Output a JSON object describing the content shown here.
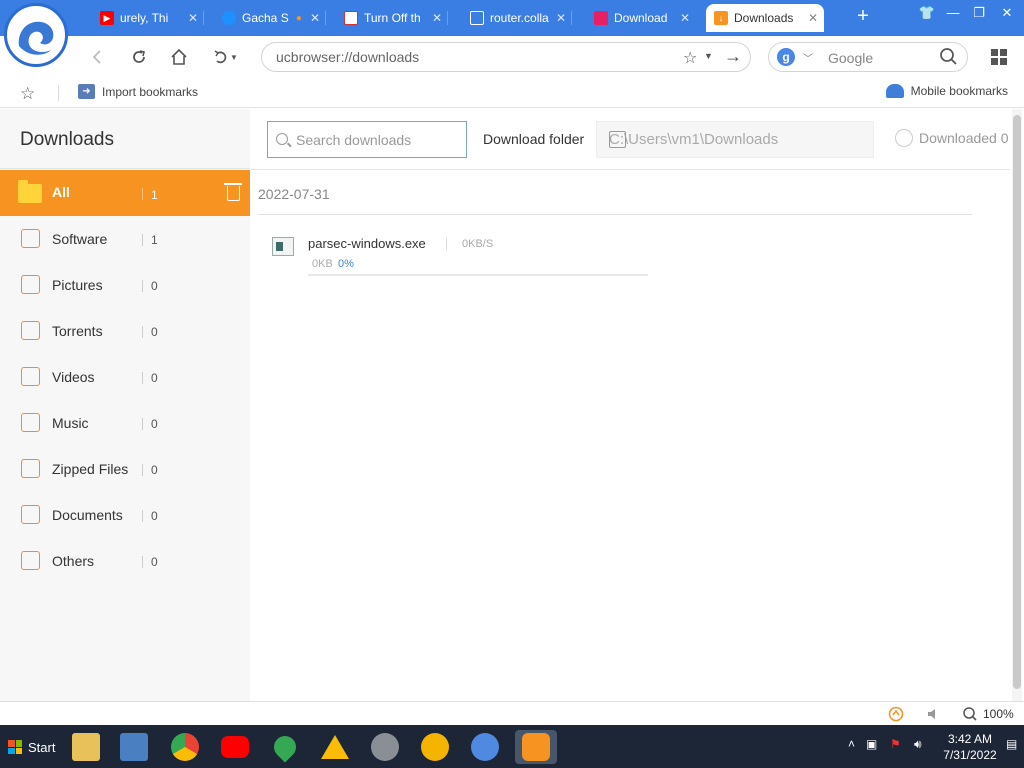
{
  "browser": {
    "tabs": [
      {
        "label": "urely, Thi",
        "icon": "youtube-icon",
        "color": "#ff0000"
      },
      {
        "label": "Gacha S",
        "icon": "edge-icon",
        "color": "#1e90ff"
      },
      {
        "label": "Turn Off th",
        "icon": "page-icon",
        "color": "#ffffff"
      },
      {
        "label": "router.colla",
        "icon": "doc-icon",
        "color": "#ffffff"
      },
      {
        "label": "Download",
        "icon": "bookmark-icon",
        "color": "#e91e63"
      },
      {
        "label": "Downloads",
        "icon": "download-icon",
        "color": "#f79421"
      }
    ],
    "address": "ucbrowser://downloads",
    "search_engine": "Google",
    "bookmarks": {
      "import_label": "Import bookmarks",
      "mobile_label": "Mobile bookmarks"
    }
  },
  "downloads_page": {
    "title": "Downloads",
    "search_placeholder": "Search downloads",
    "folder_label": "Download folder",
    "folder_path": "C:\\Users\\vm1\\Downloads",
    "downloaded_label": "Downloaded 0",
    "categories": [
      {
        "label": "All",
        "count": "1",
        "icon": "folder-icon"
      },
      {
        "label": "Software",
        "count": "1",
        "icon": "software-icon"
      },
      {
        "label": "Pictures",
        "count": "0",
        "icon": "picture-icon"
      },
      {
        "label": "Torrents",
        "count": "0",
        "icon": "torrent-icon"
      },
      {
        "label": "Videos",
        "count": "0",
        "icon": "video-icon"
      },
      {
        "label": "Music",
        "count": "0",
        "icon": "music-icon"
      },
      {
        "label": "Zipped Files",
        "count": "0",
        "icon": "zip-icon"
      },
      {
        "label": "Documents",
        "count": "0",
        "icon": "document-icon"
      },
      {
        "label": "Others",
        "count": "0",
        "icon": "others-icon"
      }
    ],
    "date_group": "2022-07-31",
    "items": [
      {
        "name": "parsec-windows.exe",
        "speed": "0KB/S",
        "size": "0KB",
        "percent": "0%",
        "progress": 0
      }
    ]
  },
  "statusbar": {
    "zoom": "100%"
  },
  "taskbar": {
    "start_label": "Start",
    "time": "3:42 AM",
    "date": "7/31/2022"
  },
  "colors": {
    "accent": "#f79421",
    "titlebar": "#3b7ee3",
    "taskbar": "#1c2636"
  }
}
